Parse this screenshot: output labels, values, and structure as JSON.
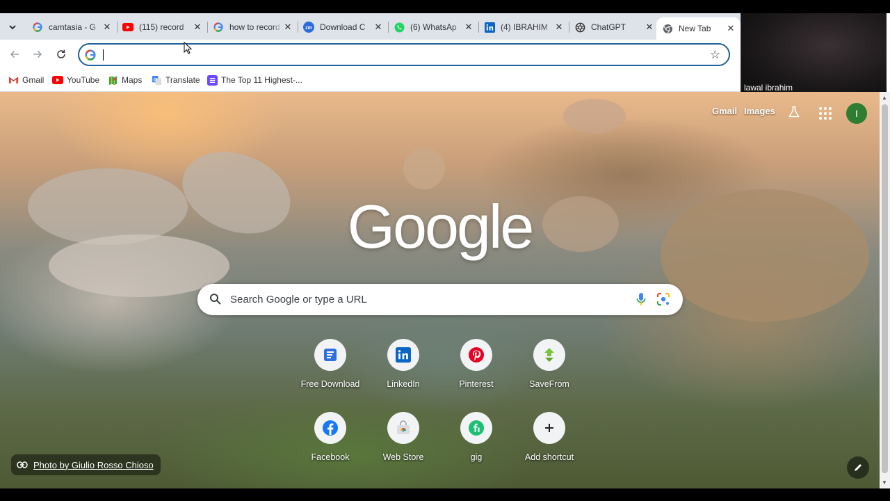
{
  "browser": {
    "tab_search_icon": "chevron-down-icon",
    "tabs": [
      {
        "title": "camtasia - G",
        "icon": "google-icon",
        "active": false
      },
      {
        "title": "(115) record",
        "icon": "youtube-icon",
        "active": false
      },
      {
        "title": "how to record",
        "icon": "google-icon",
        "active": false
      },
      {
        "title": "Download C",
        "icon": "zoom-icon",
        "active": false
      },
      {
        "title": "(6) WhatsAp",
        "icon": "whatsapp-icon",
        "active": false
      },
      {
        "title": "(4) IBRAHIM",
        "icon": "linkedin-icon",
        "active": false
      },
      {
        "title": "ChatGPT",
        "icon": "chatgpt-icon",
        "active": false
      },
      {
        "title": "New Tab",
        "icon": "chrome-icon",
        "active": true
      }
    ],
    "tab_close_glyph": "✕",
    "omnibox": {
      "value": "",
      "placeholder": ""
    },
    "bookmarks": [
      {
        "label": "Gmail",
        "icon": "gmail-icon"
      },
      {
        "label": "YouTube",
        "icon": "youtube-icon"
      },
      {
        "label": "Maps",
        "icon": "maps-icon"
      },
      {
        "label": "Translate",
        "icon": "translate-icon"
      },
      {
        "label": "The Top 11 Highest-...",
        "icon": "bookmark-site-icon"
      }
    ]
  },
  "webcam": {
    "name": "lawal ibrahim"
  },
  "ntp": {
    "top_links": {
      "gmail": "Gmail",
      "images": "Images"
    },
    "avatar_letter": "I",
    "logo": "Google",
    "search_placeholder": "Search Google or type a URL",
    "shortcuts": [
      {
        "label": "Free Download",
        "icon": "free-download-icon",
        "color": "#2f6fdc"
      },
      {
        "label": "LinkedIn",
        "icon": "linkedin-icon",
        "color": "#0a66c2"
      },
      {
        "label": "Pinterest",
        "icon": "pinterest-icon",
        "color": "#e60023"
      },
      {
        "label": "SaveFrom",
        "icon": "savefrom-icon",
        "color": "#7cc242"
      },
      {
        "label": "Facebook",
        "icon": "facebook-icon",
        "color": "#1877f2"
      },
      {
        "label": "Web Store",
        "icon": "webstore-icon",
        "color": "#ea4335"
      },
      {
        "label": "gig",
        "icon": "fiverr-icon",
        "color": "#1dbf73"
      },
      {
        "label": "Add shortcut",
        "icon": "plus-icon",
        "color": "#202124"
      }
    ],
    "photo_credit": "Photo by Giulio Rosso Chioso"
  },
  "colors": {
    "accent": "#1f5f99",
    "tabstrip": "#dee3ea",
    "avatar": "#2e7d32"
  }
}
